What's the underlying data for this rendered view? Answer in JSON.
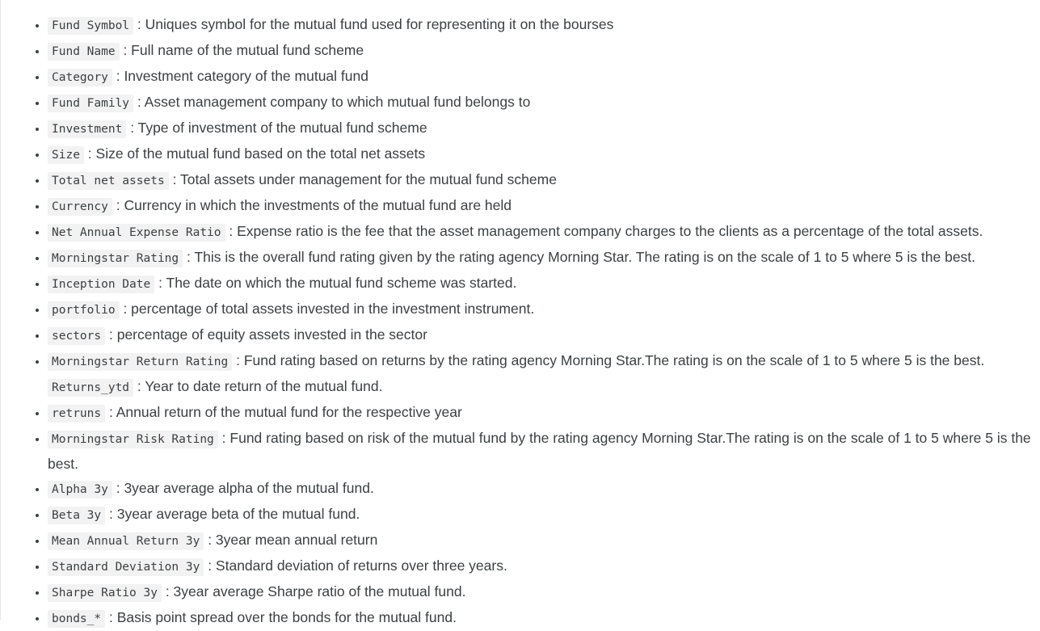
{
  "items": [
    {
      "term": "Fund Symbol",
      "desc": ": Uniques symbol for the mutual fund used for representing it on the bourses"
    },
    {
      "term": "Fund Name",
      "desc": ": Full name of the mutual fund scheme"
    },
    {
      "term": "Category",
      "desc": ": Investment category of the mutual fund"
    },
    {
      "term": "Fund Family",
      "desc": ": Asset management company to which mutual fund belongs to"
    },
    {
      "term": "Investment",
      "desc": ": Type of investment of the mutual fund scheme"
    },
    {
      "term": "Size",
      "desc": ": Size of the mutual fund based on the total net assets"
    },
    {
      "term": "Total net assets",
      "desc": ": Total assets under management for the mutual fund scheme"
    },
    {
      "term": "Currency",
      "desc": ": Currency in which the investments of the mutual fund are held"
    },
    {
      "term": "Net Annual Expense Ratio",
      "desc": ": Expense ratio is the fee that the asset management company charges to the clients as a percentage of the total assets."
    },
    {
      "term": "Morningstar Rating",
      "desc": ": This is the overall fund rating given by the rating agency Morning Star. The rating is on the scale of 1 to 5 where 5 is the best."
    },
    {
      "term": "Inception Date",
      "desc": ": The date on which the mutual fund scheme was started."
    },
    {
      "term": "portfolio",
      "desc": ": percentage of total assets invested in the investment instrument."
    },
    {
      "term": "sectors",
      "desc": ": percentage of equity assets invested in the sector"
    },
    {
      "term": "Morningstar Return Rating",
      "desc": ": Fund rating based on returns by the rating agency Morning Star.The rating is on the scale of 1 to 5 where 5 is the best.",
      "term2": "Returns_ytd",
      "desc2": ": Year to date return of the mutual fund."
    },
    {
      "term": "retruns",
      "desc": ": Annual return of the mutual fund for the respective year"
    },
    {
      "term": "Morningstar Risk Rating",
      "desc": ": Fund rating based on risk of the mutual fund by the rating agency Morning Star.The rating is on the scale of 1 to 5 where 5 is the best."
    },
    {
      "term": "Alpha 3y",
      "desc": ": 3year average alpha of the mutual fund."
    },
    {
      "term": "Beta 3y",
      "desc": ": 3year average beta of the mutual fund."
    },
    {
      "term": "Mean Annual Return 3y",
      "desc": ": 3year mean annual return"
    },
    {
      "term": "Standard Deviation 3y",
      "desc": ": Standard deviation of returns over three years."
    },
    {
      "term": "Sharpe Ratio 3y",
      "desc": ": 3year average Sharpe ratio of the mutual fund."
    },
    {
      "term": "bonds_*",
      "desc": ": Basis point spread over the bonds for the mutual fund."
    }
  ]
}
